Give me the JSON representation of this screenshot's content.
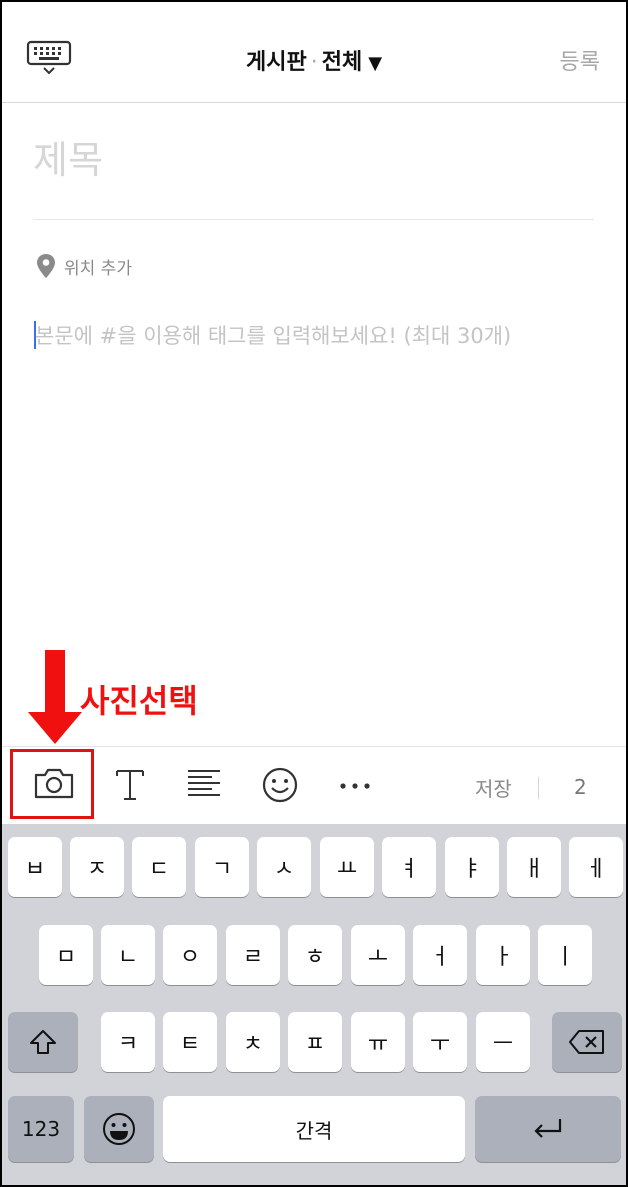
{
  "header": {
    "board": "게시판",
    "separator": "·",
    "category": "전체",
    "caret": "▼",
    "submit": "등록"
  },
  "post": {
    "title_placeholder": "제목",
    "location_label": "위치 추가",
    "body_placeholder": "본문에 #을 이용해 태그를 입력해보세요! (최대 30개)"
  },
  "annotation": {
    "text": "사진선택",
    "color": "#f01010"
  },
  "toolbar": {
    "save": "저장",
    "count": "2",
    "icons": [
      "camera-icon",
      "text-style-icon",
      "align-icon",
      "emoji-icon",
      "more-icon"
    ]
  },
  "keyboard": {
    "row1": [
      "ㅂ",
      "ㅈ",
      "ㄷ",
      "ㄱ",
      "ㅅ",
      "ㅛ",
      "ㅕ",
      "ㅑ",
      "ㅐ",
      "ㅔ"
    ],
    "row2": [
      "ㅁ",
      "ㄴ",
      "ㅇ",
      "ㄹ",
      "ㅎ",
      "ㅗ",
      "ㅓ",
      "ㅏ",
      "ㅣ"
    ],
    "row3": [
      "ㅋ",
      "ㅌ",
      "ㅊ",
      "ㅍ",
      "ㅠ",
      "ㅜ",
      "ㅡ"
    ],
    "numbers": "123",
    "space": "간격"
  }
}
